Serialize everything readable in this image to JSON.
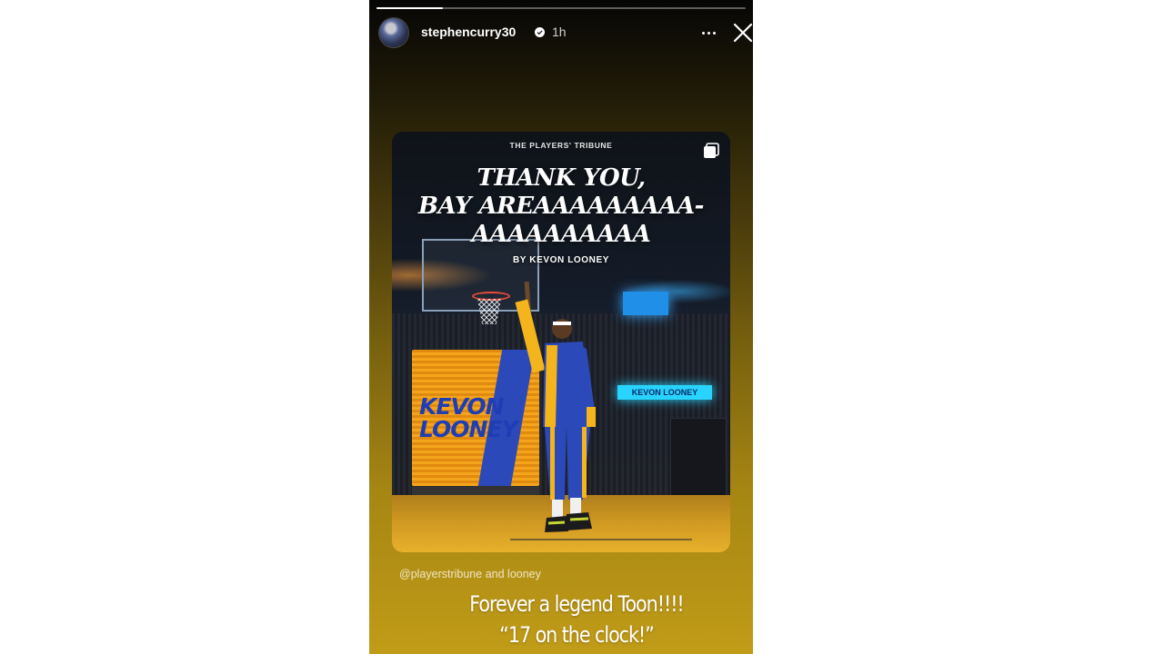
{
  "story": {
    "progress": 0.18,
    "username": "stephencurry30",
    "time_ago": "1h",
    "verified": true
  },
  "post_card": {
    "brand": "THE PLAYERS' TRIBUNE",
    "headline_lines": [
      "THANK YOU,",
      "BAY AREAAAAAAAAA-",
      "AAAAAAAAAA"
    ],
    "byline": "BY KEVON LOONEY",
    "board_text_lines": [
      "KEVON",
      "LOONEY"
    ],
    "side_sign": "KEVON LOONEY"
  },
  "mention": {
    "handle1": "@playerstribune",
    "joiner": "and",
    "handle2": "looney"
  },
  "caption_lines": [
    "Forever a legend Toon!!!!",
    "“17 on the clock!”"
  ],
  "colors": {
    "warriors_blue": "#2b49b8",
    "warriors_gold": "#f4a51c"
  }
}
